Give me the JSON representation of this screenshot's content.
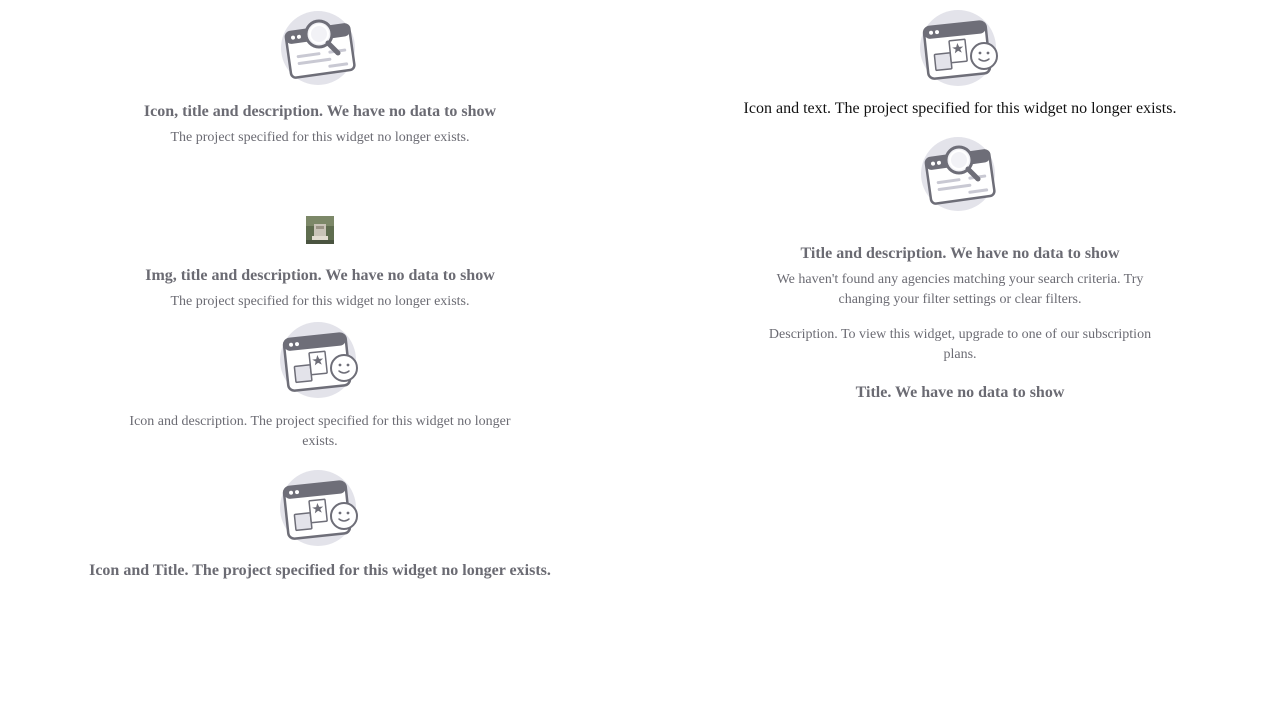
{
  "left": {
    "block1": {
      "icon": "search-browser-illustration",
      "title": "Icon, title and description. We have no data to show",
      "description": "The project specified for this widget no longer exists."
    },
    "block2": {
      "image": "thumbnail-image",
      "title": "Img, title and description. We have no data to show",
      "description": "The project specified for this widget no longer exists."
    },
    "block3": {
      "icon": "browser-window-smiley-illustration",
      "description": "Icon and description. The project specified for this widget no longer exists."
    },
    "block4": {
      "icon": "browser-window-smiley-illustration",
      "title": "Icon and Title. The project specified for this widget no longer exists."
    }
  },
  "right": {
    "block1": {
      "icon": "browser-window-smiley-illustration",
      "text": "Icon and text. The project specified for this widget no longer exists."
    },
    "block2": {
      "icon": "search-browser-illustration",
      "title": "Title and description. We have no data to show",
      "description": "We haven't found any agencies matching your search criteria. Try changing your filter settings or clear filters."
    },
    "block3": {
      "description": "Description. To view this widget, upgrade to one of our subscription plans."
    },
    "block4": {
      "title": "Title. We have no data to show"
    }
  },
  "colors": {
    "text_gray": "#6b6b73",
    "illustration_bg": "#e3e3ea",
    "illustration_dark": "#6e6e78"
  }
}
